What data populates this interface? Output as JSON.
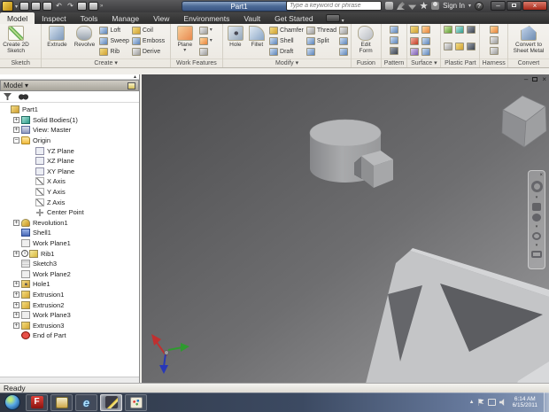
{
  "titlebar": {
    "title": "Part1",
    "search_placeholder": "Type a keyword or phrase",
    "sign_in": "Sign In",
    "help": "?",
    "minimize": "–",
    "close": "×"
  },
  "tabs": [
    "Model",
    "Inspect",
    "Tools",
    "Manage",
    "View",
    "Environments",
    "Vault",
    "Get Started"
  ],
  "ribbon": {
    "panels": {
      "sketch": "Sketch",
      "create": "Create ▾",
      "work_features": "Work Features",
      "modify": "Modify ▾",
      "fusion": "Fusion",
      "pattern": "Pattern",
      "surface": "Surface ▾",
      "plastic": "Plastic Part",
      "harness": "Harness",
      "convert": "Convert"
    },
    "buttons": {
      "create_2d_sketch": "Create 2D Sketch",
      "extrude": "Extrude",
      "revolve": "Revolve",
      "loft": "Loft",
      "sweep": "Sweep",
      "rib": "Rib",
      "coil": "Coil",
      "emboss": "Emboss",
      "derive": "Derive",
      "plane": "Plane",
      "hole": "Hole",
      "fillet": "Fillet",
      "chamfer": "Chamfer",
      "shell": "Shell",
      "draft": "Draft",
      "thread": "Thread",
      "split": "Split",
      "edit_form": "Edit Form",
      "convert_to_sheet_metal": "Convert to Sheet Metal"
    }
  },
  "browser": {
    "header": "Model ▾",
    "tree": [
      {
        "label": "Part1",
        "exp": "",
        "icon": "part-icon"
      },
      {
        "label": "Solid Bodies(1)",
        "exp": "+",
        "icon": "solid-bodies-icon"
      },
      {
        "label": "View: Master",
        "exp": "+",
        "icon": "view-rep-icon"
      },
      {
        "label": "Origin",
        "exp": "−",
        "icon": "origin-folder-icon"
      },
      {
        "label": "YZ Plane",
        "exp": "",
        "icon": "plane-icon"
      },
      {
        "label": "XZ Plane",
        "exp": "",
        "icon": "plane-icon"
      },
      {
        "label": "XY Plane",
        "exp": "",
        "icon": "plane-icon"
      },
      {
        "label": "X Axis",
        "exp": "",
        "icon": "axis-icon"
      },
      {
        "label": "Y Axis",
        "exp": "",
        "icon": "axis-icon"
      },
      {
        "label": "Z Axis",
        "exp": "",
        "icon": "axis-icon"
      },
      {
        "label": "Center Point",
        "exp": "",
        "icon": "center-point-icon"
      },
      {
        "label": "Revolution1",
        "exp": "+",
        "icon": "revolution-icon"
      },
      {
        "label": "Shell1",
        "exp": "",
        "icon": "shell-icon"
      },
      {
        "label": "Work Plane1",
        "exp": "",
        "icon": "work-plane-icon"
      },
      {
        "label": "Rib1",
        "exp": "+",
        "icon": "rib-icon",
        "warning": "i"
      },
      {
        "label": "Sketch3",
        "exp": "",
        "icon": "sketch-icon"
      },
      {
        "label": "Work Plane2",
        "exp": "",
        "icon": "work-plane-icon"
      },
      {
        "label": "Hole1",
        "exp": "+",
        "icon": "hole-icon"
      },
      {
        "label": "Extrusion1",
        "exp": "+",
        "icon": "extrusion-icon"
      },
      {
        "label": "Extrusion2",
        "exp": "+",
        "icon": "extrusion-icon"
      },
      {
        "label": "Work Plane3",
        "exp": "+",
        "icon": "work-plane-icon"
      },
      {
        "label": "Extrusion3",
        "exp": "+",
        "icon": "extrusion-icon"
      },
      {
        "label": "End of Part",
        "exp": "",
        "icon": "end-of-part-icon"
      }
    ]
  },
  "statusbar": {
    "text": "Ready"
  },
  "taskbar": {
    "time": "6:14 AM",
    "date": "6/15/2011",
    "icons": {
      "f_app": "F",
      "internet_explorer": "e"
    }
  }
}
